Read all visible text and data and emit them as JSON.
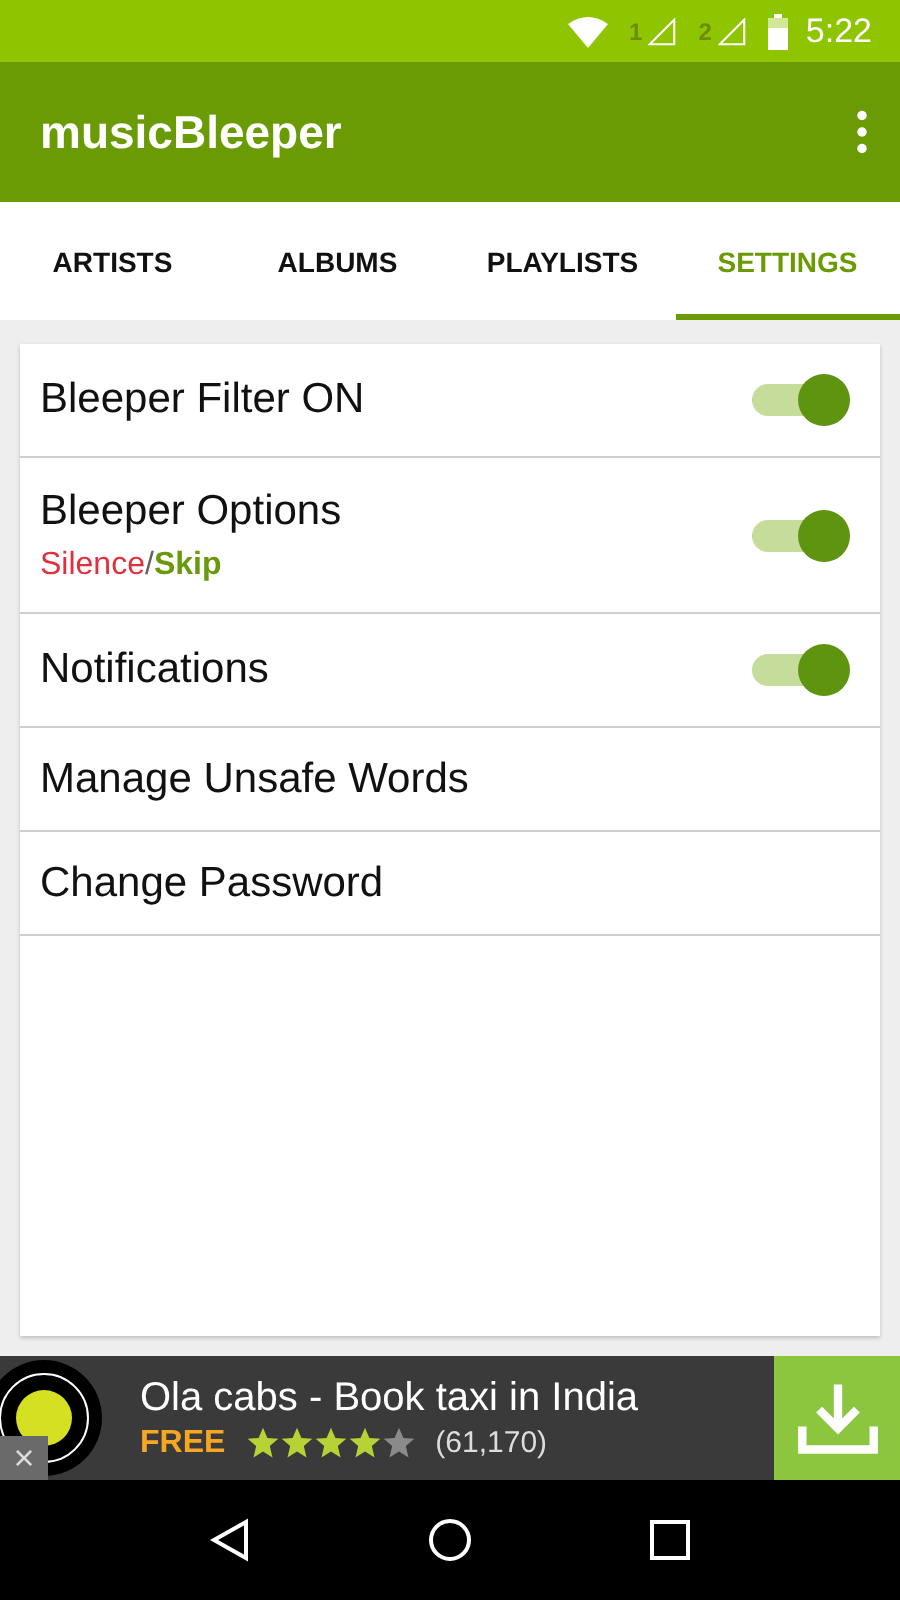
{
  "status_bar": {
    "sim_1": "1",
    "sim_2": "2",
    "time": "5:22"
  },
  "app_bar": {
    "title": "musicBleeper"
  },
  "tabs": [
    {
      "label": "ARTISTS",
      "selected": false
    },
    {
      "label": "ALBUMS",
      "selected": false
    },
    {
      "label": "PLAYLISTS",
      "selected": false
    },
    {
      "label": "SETTINGS",
      "selected": true
    }
  ],
  "settings": [
    {
      "kind": "switch",
      "label": "Bleeper Filter ON",
      "on": true
    },
    {
      "kind": "switch",
      "label": "Bleeper Options",
      "on": true,
      "subtitle": [
        {
          "text": "Silence",
          "color": "#e0303d",
          "bold": false
        },
        {
          "text": "/",
          "color": "#616161",
          "bold": false
        },
        {
          "text": "Skip",
          "color": "#6a9a0c",
          "bold": true
        }
      ]
    },
    {
      "kind": "switch",
      "label": "Notifications",
      "on": true
    },
    {
      "kind": "link",
      "label": "Manage Unsafe Words"
    },
    {
      "kind": "link",
      "label": "Change Password"
    }
  ],
  "ad": {
    "title": "Ola cabs - Book taxi in India",
    "price": "FREE",
    "stars": 4,
    "count": "(61,170)",
    "close": "×"
  }
}
